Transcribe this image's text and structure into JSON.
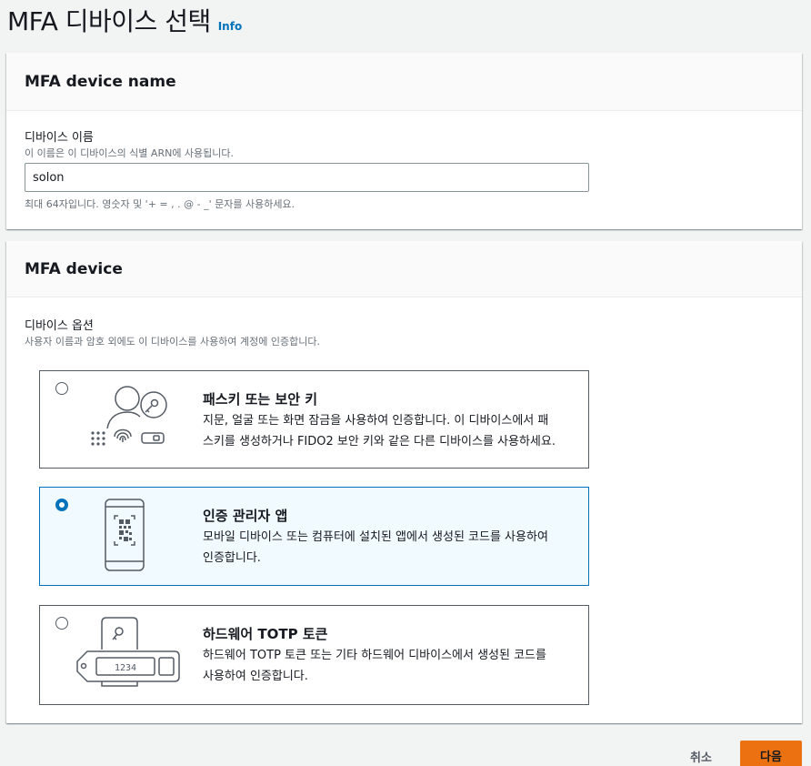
{
  "header": {
    "title": "MFA 디바이스 선택",
    "info_label": "Info"
  },
  "device_name_panel": {
    "title": "MFA device name",
    "label": "디바이스 이름",
    "description": "이 이름은 이 디바이스의 식별 ARN에 사용됩니다.",
    "value": "solon",
    "constraint": "최대 64자입니다. 영숫자 및 '+ = , . @ - _' 문자를 사용하세요."
  },
  "device_panel": {
    "title": "MFA device",
    "label": "디바이스 옵션",
    "description": "사용자 이름과 암호 외에도 이 디바이스를 사용하여 계정에 인증합니다.",
    "options": [
      {
        "title": "패스키 또는 보안 키",
        "line1": "지문, 얼굴 또는 화면 잠금을 사용하여 인증합니다. 이 디바이스에서 패",
        "line2": "스키를 생성하거나 FIDO2 보안 키와 같은 다른 디바이스를 사용하세요.",
        "selected": false
      },
      {
        "title": "인증 관리자 앱",
        "line1": "모바일 디바이스 또는 컴퓨터에 설치된 앱에서 생성된 코드를 사용하여",
        "line2": "인증합니다.",
        "selected": true
      },
      {
        "title": "하드웨어 TOTP 토큰",
        "line1": "하드웨어 TOTP 토큰 또는 기타 하드웨어 디바이스에서 생성된 코드를",
        "line2": "사용하여 인증합니다.",
        "selected": false,
        "token_display": "1234"
      }
    ]
  },
  "footer": {
    "cancel_label": "취소",
    "next_label": "다음"
  },
  "colors": {
    "accent": "#0073bb",
    "primary_button": "#ec7211",
    "selected_bg": "#f1faff"
  }
}
